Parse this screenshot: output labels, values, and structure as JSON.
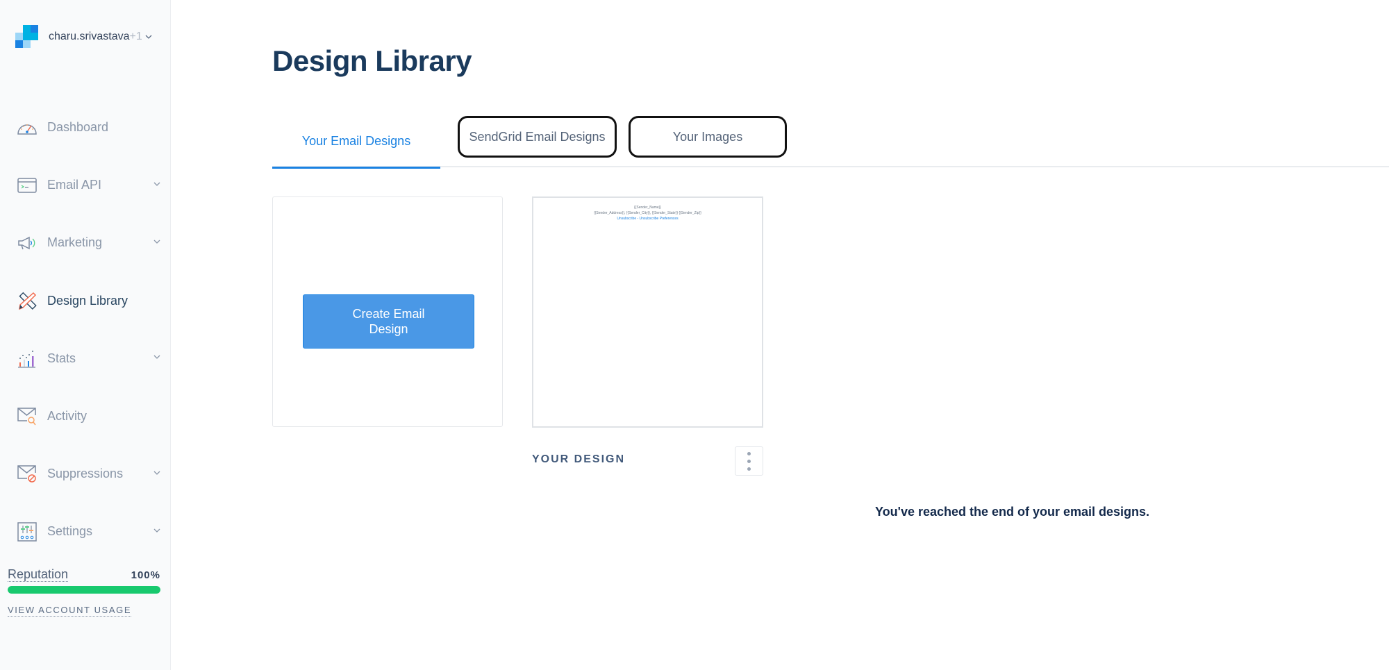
{
  "account": {
    "name": "charu.srivastava",
    "name_suffix": "+1",
    "logo_colors": [
      "#9dd6f7",
      "#1a82e2",
      "#00b2e3",
      "#1a82e2"
    ]
  },
  "sidebar": {
    "items": [
      {
        "label": "Dashboard",
        "icon": "dashboard-gauge-icon",
        "has_chevron": false,
        "active": false
      },
      {
        "label": "Email API",
        "icon": "terminal-window-icon",
        "has_chevron": true,
        "active": false
      },
      {
        "label": "Marketing",
        "icon": "megaphone-icon",
        "has_chevron": true,
        "active": false
      },
      {
        "label": "Design Library",
        "icon": "pencil-ruler-icon",
        "has_chevron": false,
        "active": true
      },
      {
        "label": "Stats",
        "icon": "bar-chart-icon",
        "has_chevron": true,
        "active": false
      },
      {
        "label": "Activity",
        "icon": "envelope-search-icon",
        "has_chevron": false,
        "active": false
      },
      {
        "label": "Suppressions",
        "icon": "envelope-blocked-icon",
        "has_chevron": true,
        "active": false
      },
      {
        "label": "Settings",
        "icon": "sliders-icon",
        "has_chevron": true,
        "active": false
      }
    ],
    "reputation": {
      "label": "Reputation",
      "value_text": "100%",
      "value_percent": 100,
      "bar_color": "#18c96e"
    },
    "usage_link": "VIEW ACCOUNT USAGE"
  },
  "main": {
    "title": "Design Library",
    "tabs": [
      {
        "label": "Your Email Designs",
        "active": true
      },
      {
        "label": "SendGrid Email Designs",
        "active": false
      },
      {
        "label": "Your Images",
        "active": false
      }
    ],
    "create_button": "Create Email Design",
    "design": {
      "name": "YOUR DESIGN",
      "preview_lines": [
        "{{Sender_Name}}",
        "{{Sender_Address}}, {{Sender_City}}, {{Sender_State}} {{Sender_Zip}}",
        "Unsubscribe - Unsubscribe Preferences"
      ]
    },
    "end_message": "You've reached the end of your email designs.",
    "accent_color": "#1a82e2"
  }
}
